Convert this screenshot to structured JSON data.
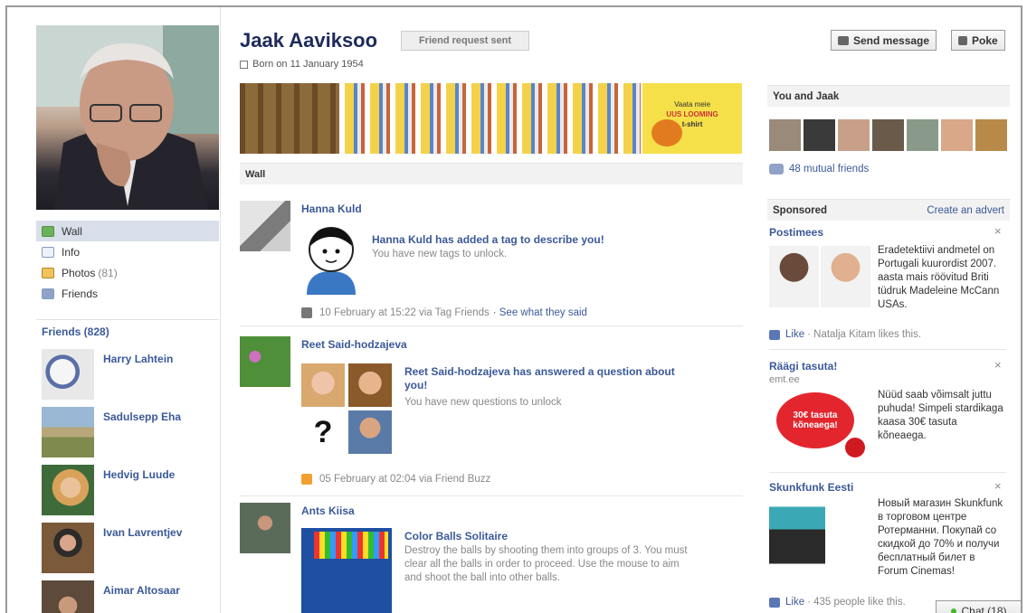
{
  "profile": {
    "name": "Jaak Aaviksoo",
    "friend_request": "Friend request sent",
    "born": "Born on 11 January 1954",
    "send_message": "Send message",
    "poke": "Poke"
  },
  "nav": {
    "wall": "Wall",
    "info": "Info",
    "photos": "Photos",
    "photos_count": "(81)",
    "friends": "Friends"
  },
  "friends_box": {
    "heading": "Friends (828)",
    "list": [
      "Harry Lahtein",
      "Sadulsepp Eha",
      "Hedvig Luude",
      "Ivan Lavrentjev",
      "Aimar Altosaar"
    ]
  },
  "wall_label": "Wall",
  "posts": [
    {
      "author": "Hanna Kuld",
      "title": "Hanna Kuld has added a tag to describe you!",
      "desc": "You have new tags to unlock.",
      "meta": "10 February at 15:22 via Tag Friends",
      "see": "· See what they said"
    },
    {
      "author": "Reet Said-hodzajeva",
      "title": "Reet Said-hodzajeva has answered a question about you!",
      "desc": "You have new questions to unlock",
      "meta": "05 February at 02:04 via Friend Buzz"
    },
    {
      "author": "Ants Kiisa",
      "title": "Color Balls Solitaire",
      "desc": "Destroy the balls by shooting them into groups of 3. You must clear all the balls in order to proceed. Use the mouse to aim and shoot the ball into other balls."
    }
  ],
  "you_and": {
    "heading": "You and Jaak",
    "mutual": "48 mutual friends"
  },
  "sponsored": {
    "heading": "Sponsored",
    "create": "Create an advert",
    "ads": [
      {
        "title": "Postimees",
        "body": "Eradetektiivi andmetel on Portugali kuurordist 2007. aasta mais röövitud Briti tüdruk Madeleine McCann USAs.",
        "like": "Like",
        "like_text": "· Natalja Kitam likes this."
      },
      {
        "title": "Räägi tasuta!",
        "sub": "emt.ee",
        "body": "Nüüd saab võimsalt juttu puhuda! Simpeli stardikaga kaasa 30€ tasuta kõneaega.",
        "bubble": "30€ tasuta kõneaega!"
      },
      {
        "title": "Skunkfunk Eesti",
        "body": "Новый магазин Skunkfunk в торговом центре Ротерманни. Покупай со скидкой до 70% и получи бесплатный билет в Forum Cinemas!",
        "like": "Like",
        "like_text": "· 435 people like this."
      }
    ],
    "close": "×"
  },
  "chat": "Chat (18)",
  "strip_text": {
    "line1": "Vaata meie",
    "line2": "UUS LOOMING",
    "line3": "t-shirt"
  }
}
